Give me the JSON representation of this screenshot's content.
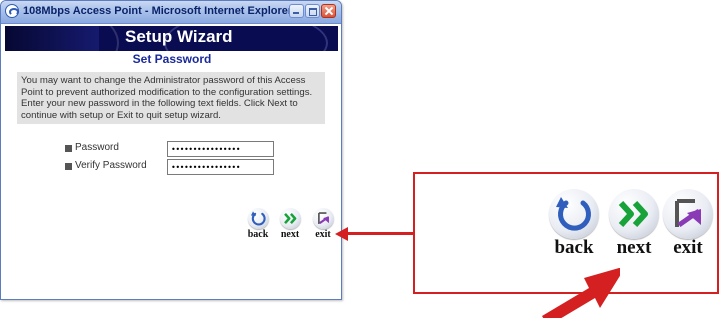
{
  "window": {
    "title": "108Mbps Access Point - Microsoft Internet Explorer"
  },
  "wizard": {
    "title": "Setup Wizard",
    "subtitle": "Set Password",
    "description": "You may want to change the Administrator password of this Access Point to prevent authorized modification to the configuration settings. Enter your new password in the following text fields. Click Next to continue with setup or Exit to quit setup wizard."
  },
  "form": {
    "password_label": "Password",
    "password_value": "••••••••••••••••",
    "verify_label": "Verify Password",
    "verify_value": "••••••••••••••••"
  },
  "buttons": {
    "back": "back",
    "next": "next",
    "exit": "exit"
  },
  "icons": {
    "back": "circular-arrow-icon",
    "next": "double-chevron-right-icon",
    "exit": "exit-arrow-icon"
  },
  "colors": {
    "banner": "#0a0c52",
    "subtitle": "#1a2a9a",
    "callout_red": "#d42020",
    "back_blue": "#2f5ebd",
    "next_green": "#17a23a",
    "exit_purple": "#8a3ab5"
  }
}
